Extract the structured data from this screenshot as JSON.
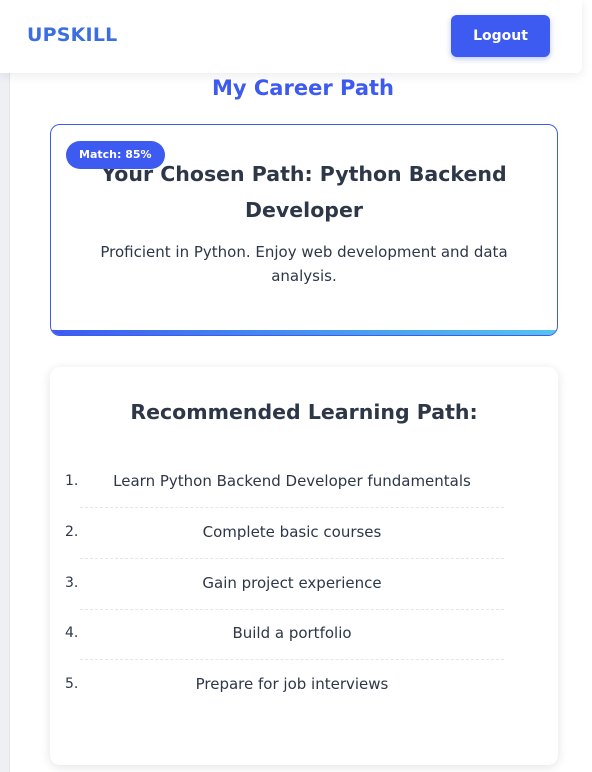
{
  "header": {
    "logo": "UPSKILL",
    "logout_label": "Logout"
  },
  "page": {
    "title": "My Career Path"
  },
  "chosen_path": {
    "badge": "Match: 85%",
    "title": "Your Chosen Path: Python Backend Developer",
    "description": "Proficient in Python. Enjoy web development and data analysis."
  },
  "learning_path": {
    "title": "Recommended Learning Path:",
    "steps": [
      {
        "number": "1.",
        "text": "Learn Python Backend Developer fundamentals"
      },
      {
        "number": "2.",
        "text": "Complete basic courses"
      },
      {
        "number": "3.",
        "text": "Gain project experience"
      },
      {
        "number": "4.",
        "text": "Build a portfolio"
      },
      {
        "number": "5.",
        "text": "Prepare for job interviews"
      }
    ]
  },
  "colors": {
    "accent": "#3d5af1",
    "logo": "#3b6ee0",
    "text": "#2d3748",
    "gradient_end": "#56c3ee"
  }
}
